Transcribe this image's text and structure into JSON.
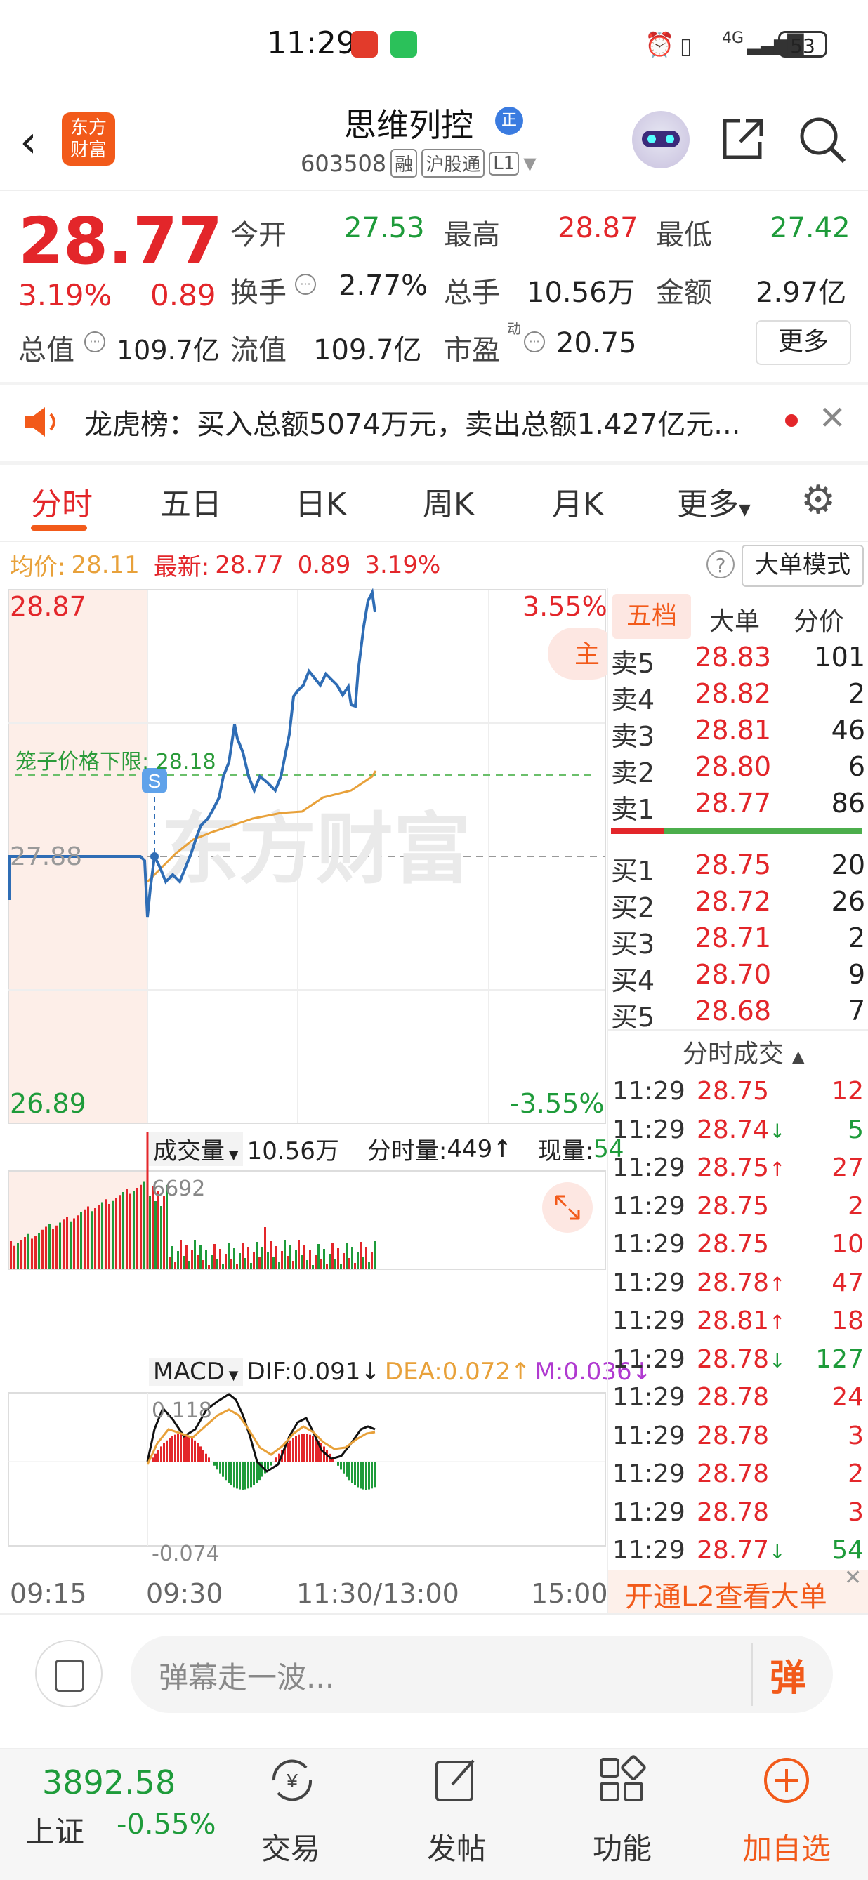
{
  "status_bar": {
    "time": "11:29",
    "signal": "4G",
    "battery": "53"
  },
  "header": {
    "logo_line1": "东方",
    "logo_line2": "财富",
    "stock_name": "思维列控",
    "badge": "正",
    "code": "603508",
    "tags": [
      "融",
      "沪股通",
      "L1"
    ]
  },
  "quote": {
    "price": "28.77",
    "change_pct": "3.19%",
    "change": "0.89",
    "open_label": "今开",
    "open": "27.53",
    "high_label": "最高",
    "high": "28.87",
    "low_label": "最低",
    "low": "27.42",
    "turnover_label": "换手",
    "turnover": "2.77%",
    "volume_label": "总手",
    "volume": "10.56万",
    "amount_label": "金额",
    "amount": "2.97亿",
    "mcap_label": "总值",
    "mcap": "109.7亿",
    "float_label": "流值",
    "float": "109.7亿",
    "pe_label": "市盈",
    "pe_sup": "动",
    "pe": "20.75",
    "more": "更多"
  },
  "banner": {
    "text": "龙虎榜：买入总额5074万元，卖出总额1.427亿元..."
  },
  "tabs": {
    "items": [
      "分时",
      "五日",
      "日K",
      "周K",
      "月K",
      "更多"
    ],
    "active": "分时"
  },
  "price_line": {
    "avg_label": "均价:",
    "avg": "28.11",
    "last_label": "最新:",
    "last": "28.77",
    "change": "0.89",
    "change_pct": "3.19%",
    "big_order_mode": "大单模式"
  },
  "chart": {
    "y_max": "28.87",
    "y_min": "26.89",
    "y_mid": "27.88",
    "pct_max": "3.55%",
    "pct_min": "-3.55%",
    "cage_label": "笼子价格下限: 28.18",
    "main_label": "主",
    "s_marker": "S",
    "watermark": "东方财富",
    "volume_label": "成交量",
    "volume_total": "10.56万",
    "minute_vol_label": "分时量:",
    "minute_vol": "449",
    "current_vol_label": "现量:",
    "current_vol": "54",
    "vol_max": "6692",
    "macd_label": "MACD",
    "dif": "DIF:0.091",
    "dea": "DEA:0.072",
    "m": "M:0.036",
    "macd_max": "0.118",
    "macd_min": "-0.074",
    "x_labels": [
      "09:15",
      "09:30",
      "11:30/13:00",
      "15:00"
    ]
  },
  "order_book": {
    "tabs": [
      "五档",
      "大单",
      "分价"
    ],
    "asks": [
      {
        "label": "卖5",
        "price": "28.83",
        "vol": "101"
      },
      {
        "label": "卖4",
        "price": "28.82",
        "vol": "2"
      },
      {
        "label": "卖3",
        "price": "28.81",
        "vol": "46"
      },
      {
        "label": "卖2",
        "price": "28.80",
        "vol": "6"
      },
      {
        "label": "卖1",
        "price": "28.77",
        "vol": "86"
      }
    ],
    "bids": [
      {
        "label": "买1",
        "price": "28.75",
        "vol": "20"
      },
      {
        "label": "买2",
        "price": "28.72",
        "vol": "26"
      },
      {
        "label": "买3",
        "price": "28.71",
        "vol": "2"
      },
      {
        "label": "买4",
        "price": "28.70",
        "vol": "9"
      },
      {
        "label": "买5",
        "price": "28.68",
        "vol": "7"
      }
    ]
  },
  "trades": {
    "title": "分时成交",
    "rows": [
      {
        "time": "11:29",
        "price": "28.75",
        "dir": "",
        "vol": "12"
      },
      {
        "time": "11:29",
        "price": "28.74",
        "dir": "↓",
        "vol": "5"
      },
      {
        "time": "11:29",
        "price": "28.75",
        "dir": "↑",
        "vol": "27"
      },
      {
        "time": "11:29",
        "price": "28.75",
        "dir": "",
        "vol": "2"
      },
      {
        "time": "11:29",
        "price": "28.75",
        "dir": "",
        "vol": "10"
      },
      {
        "time": "11:29",
        "price": "28.78",
        "dir": "↑",
        "vol": "47"
      },
      {
        "time": "11:29",
        "price": "28.81",
        "dir": "↑",
        "vol": "18"
      },
      {
        "time": "11:29",
        "price": "28.78",
        "dir": "↓",
        "vol": "127"
      },
      {
        "time": "11:29",
        "price": "28.78",
        "dir": "",
        "vol": "24"
      },
      {
        "time": "11:29",
        "price": "28.78",
        "dir": "",
        "vol": "3"
      },
      {
        "time": "11:29",
        "price": "28.78",
        "dir": "",
        "vol": "2"
      },
      {
        "time": "11:29",
        "price": "28.78",
        "dir": "",
        "vol": "3"
      },
      {
        "time": "11:29",
        "price": "28.77",
        "dir": "↓",
        "vol": "54"
      }
    ],
    "l2_promo": "开通L2查看大单"
  },
  "danmu": {
    "placeholder": "弹幕走一波...",
    "button": "弹"
  },
  "bottom_nav": {
    "index_value": "3892.58",
    "index_name": "上证",
    "index_change": "-0.55%",
    "items": [
      "交易",
      "发帖",
      "功能",
      "加自选"
    ]
  },
  "colors": {
    "up": "#e3262a",
    "down": "#1e9b3a",
    "accent": "#f25a1a",
    "price_line": "#2f6db5",
    "avg_line": "#e8a13a"
  }
}
